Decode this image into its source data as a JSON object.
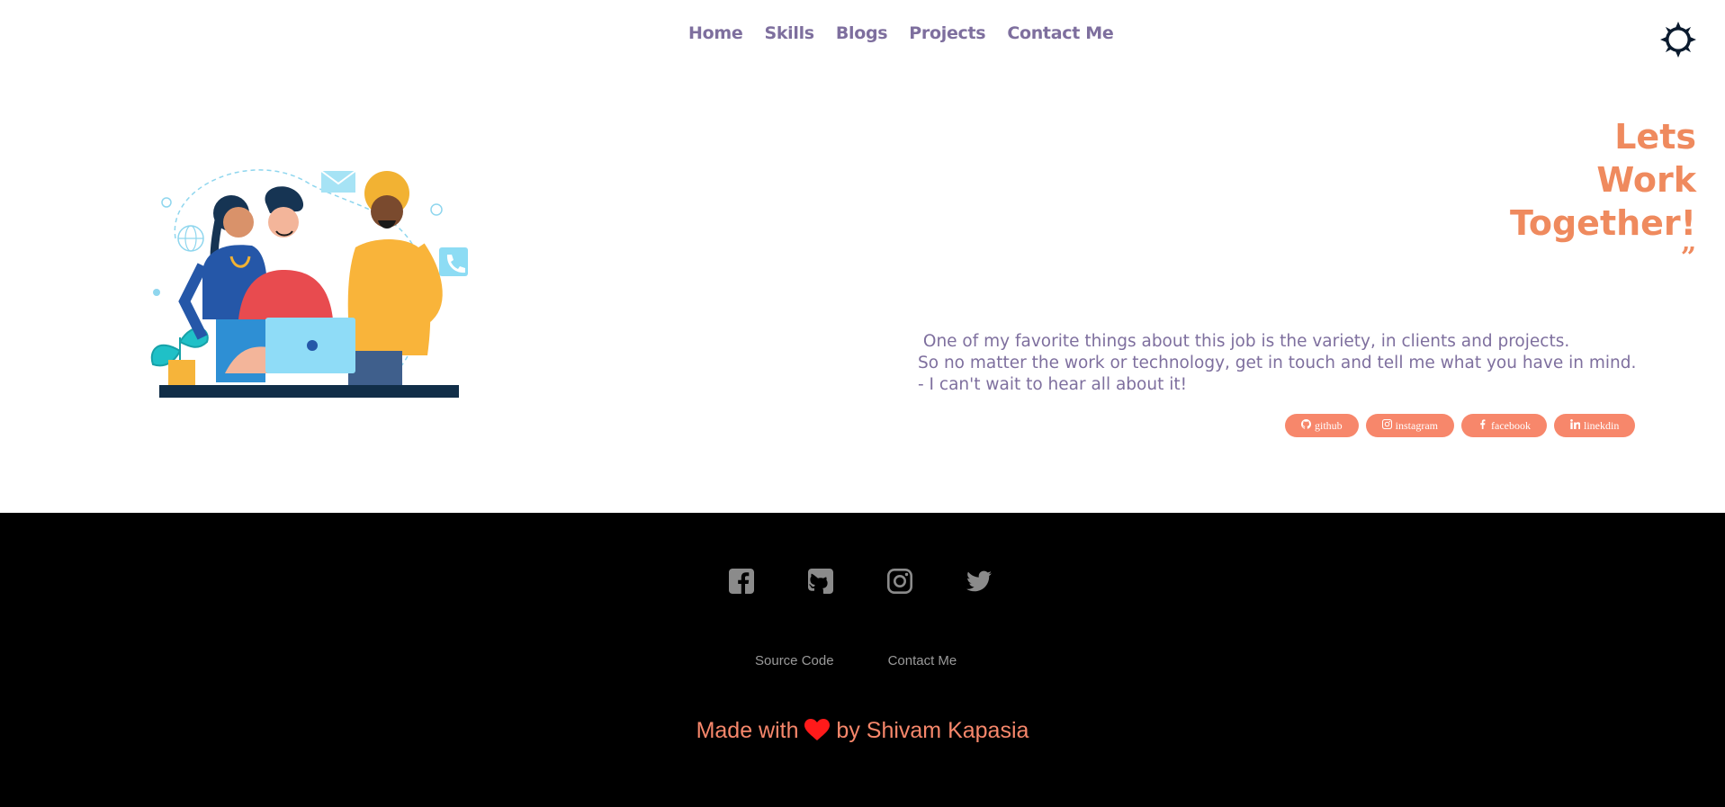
{
  "nav": {
    "links": [
      {
        "label": "Home"
      },
      {
        "label": "Skills"
      },
      {
        "label": "Blogs"
      },
      {
        "label": "Projects"
      },
      {
        "label": "Contact Me"
      }
    ],
    "theme_toggle_icon": "sun-icon"
  },
  "hero": {
    "illustration": "team-collaboration-illustration",
    "headline_lines": [
      "Lets",
      "Work",
      "Together!"
    ],
    "quote_mark": "”",
    "body_lines": [
      " One of my favorite things about this job is the variety, in clients and projects.",
      "So no matter the work or technology, get in touch and tell me what you have in mind.",
      "- I can't wait to hear all about it!"
    ],
    "social_buttons": [
      {
        "label": "github",
        "icon": "github-icon"
      },
      {
        "label": "instagram",
        "icon": "instagram-icon"
      },
      {
        "label": "facebook",
        "icon": "facebook-icon"
      },
      {
        "label": "linekdin",
        "icon": "linkedin-icon"
      }
    ]
  },
  "footer": {
    "icons": [
      "facebook-icon",
      "github-icon",
      "instagram-icon",
      "twitter-icon"
    ],
    "links": [
      {
        "label": "Source Code"
      },
      {
        "label": "Contact Me"
      }
    ],
    "made_with_prefix": "Made with",
    "made_with_suffix": "by Shivam Kapasia"
  },
  "colors": {
    "accent": "#f7876b",
    "headline": "#ef8a5e",
    "nav_text": "#7e6f9e",
    "footer_bg": "#000000",
    "footer_icon": "#8b8b8b",
    "heart": "#ff1a1a"
  }
}
